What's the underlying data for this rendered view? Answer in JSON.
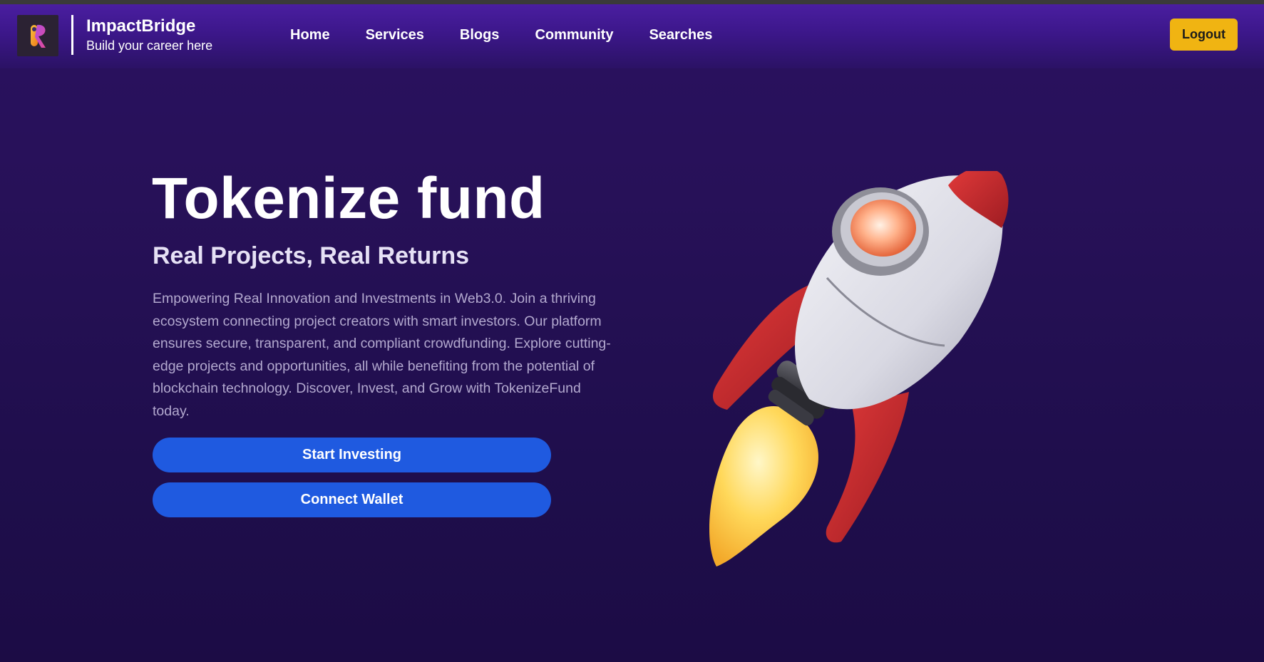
{
  "brand": {
    "name": "ImpactBridge",
    "tagline": "Build your career here",
    "logo_icon": "impactbridge-logo-icon"
  },
  "nav": {
    "links": [
      "Home",
      "Services",
      "Blogs",
      "Community",
      "Searches"
    ]
  },
  "header": {
    "logout_label": "Logout"
  },
  "hero": {
    "title": "Tokenize fund",
    "subtitle": "Real Projects, Real Returns",
    "description": "Empowering Real Innovation and Investments in Web3.0. Join a thriving ecosystem connecting project creators with smart investors. Our platform ensures secure, transparent, and compliant crowdfunding. Explore cutting-edge projects and opportunities, all while benefiting from the potential of blockchain technology. Discover, Invest, and Grow with TokenizeFund today.",
    "start_label": "Start Investing",
    "wallet_label": "Connect Wallet",
    "illustration": "rocket-illustration"
  },
  "colors": {
    "background": "#231050",
    "navbar": "#3c178a",
    "logout": "#f0b412",
    "cta": "#1f5ae0"
  }
}
